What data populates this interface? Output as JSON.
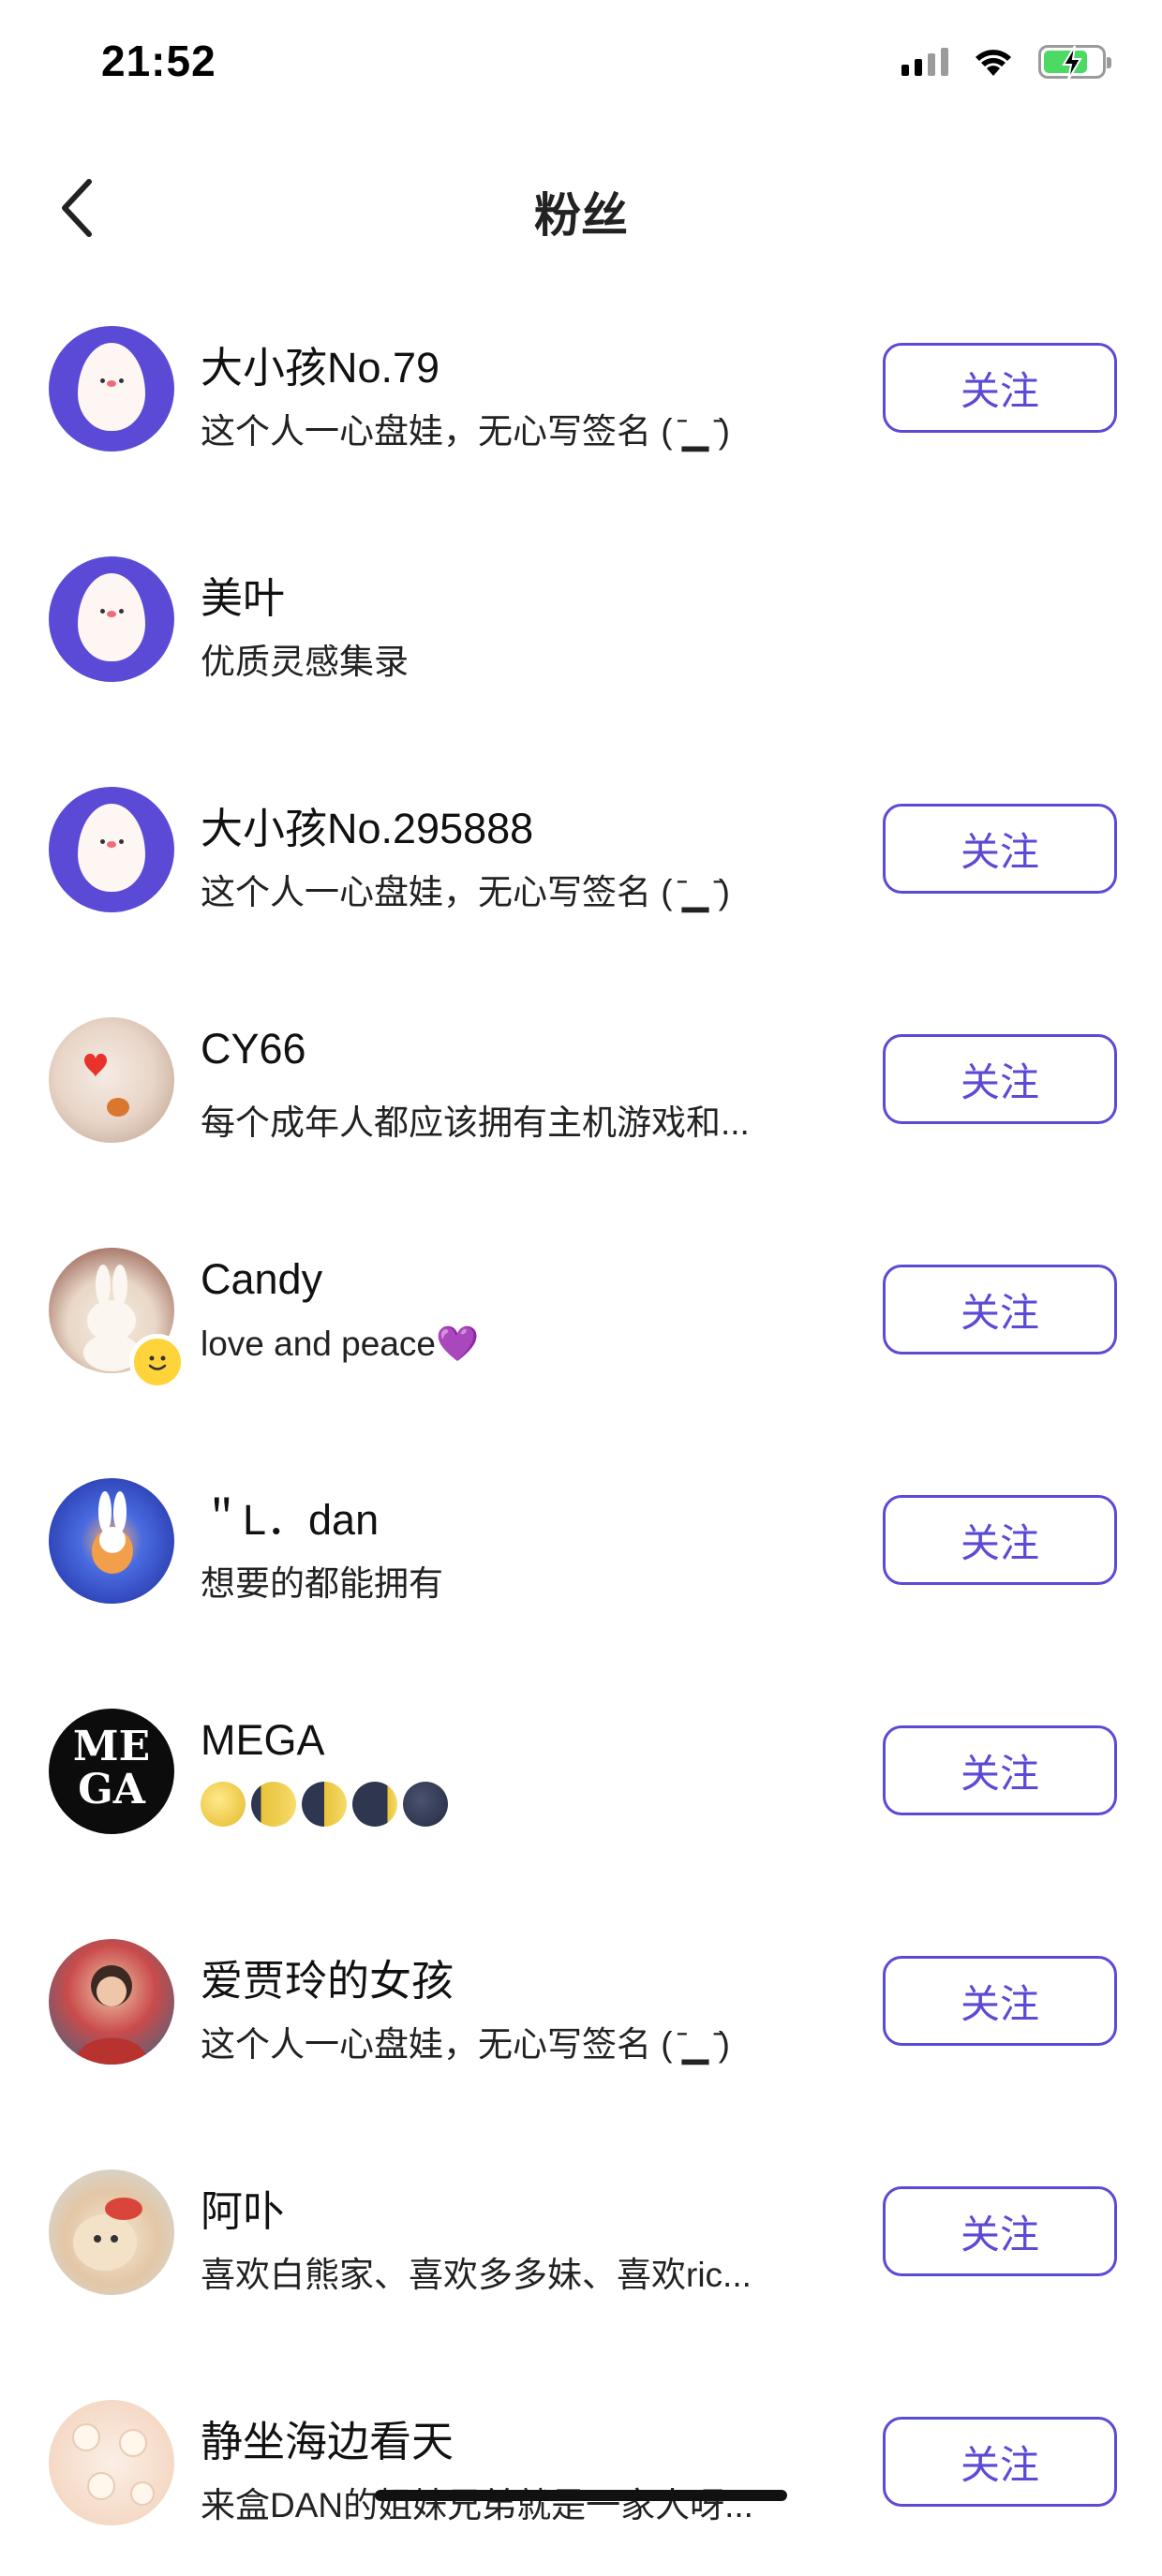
{
  "status_bar": {
    "time": "21:52",
    "icons": [
      "signal-icon",
      "wifi-icon",
      "battery-charging-icon"
    ],
    "battery_level": 0.7
  },
  "header": {
    "title": "粉丝",
    "back_icon": "chevron-left-icon"
  },
  "colors": {
    "accent": "#5a4ad6",
    "battery_green": "#4cd964"
  },
  "followers": [
    {
      "name": "大小孩No.79",
      "bio": "这个人一心盘娃，无心写签名 ( ̄▁ ̄)",
      "follow_label": "关注",
      "avatar": "egg-avatar"
    },
    {
      "name": "美叶",
      "bio": "优质灵感集录",
      "avatar": "egg-avatar"
    },
    {
      "name": "大小孩No.295888",
      "bio": "这个人一心盘娃，无心写签名 ( ̄▁ ̄)",
      "follow_label": "关注",
      "avatar": "egg-avatar"
    },
    {
      "name": "CY66",
      "bio": "每个成年人都应该拥有主机游戏和...",
      "follow_label": "关注",
      "avatar": "cat-photo-avatar"
    },
    {
      "name": "Candy",
      "bio": "love and peace💜",
      "follow_label": "关注",
      "avatar": "bunny-photo-avatar"
    },
    {
      "name": "＂L．dan",
      "bio": "想要的都能拥有",
      "follow_label": "关注",
      "avatar": "blue-illustration-avatar"
    },
    {
      "name": "MEGA",
      "bio": "",
      "follow_label": "关注",
      "avatar": "mega-avatar",
      "avatar_text": "MEGA",
      "moons": [
        "full-moon",
        "waxing-gibbous",
        "first-quarter",
        "waxing-crescent",
        "new-moon"
      ]
    },
    {
      "name": "爱贾玲的女孩",
      "bio": "这个人一心盘娃，无心写签名 ( ̄▁ ̄)",
      "follow_label": "关注",
      "avatar": "woman-photo-avatar"
    },
    {
      "name": "阿卟",
      "bio": "喜欢白熊家、喜欢多多妹、喜欢ric...",
      "follow_label": "关注",
      "avatar": "bear-photo-avatar"
    },
    {
      "name": "静坐海边看天",
      "bio": "来盒DAN的姐妹兄弟就是一家人呀...",
      "follow_label": "关注",
      "avatar": "pattern-avatar"
    }
  ]
}
